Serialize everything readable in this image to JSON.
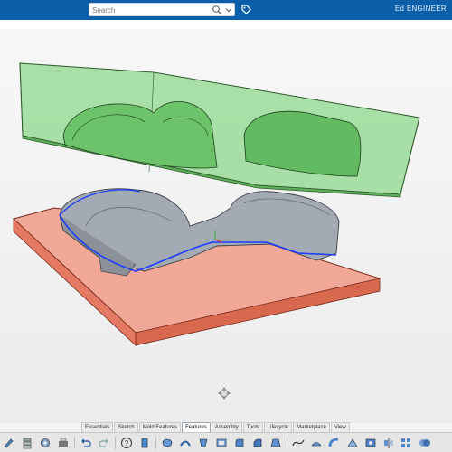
{
  "header": {
    "search_placeholder": "Search",
    "user_name": "Ed ENGINEER",
    "brand_color": "#0b5fa8"
  },
  "icons": {
    "search": "magnifier-icon",
    "dropdown": "chevron-down-icon",
    "tag": "tag-icon",
    "compass": "move-compass-icon"
  },
  "model": {
    "upper_mold_color": "#7ccf7a",
    "lower_mold_color": "#f08a73",
    "part_color": "#9aa0a8",
    "parting_line_color": "#1a3cff"
  },
  "tabs": [
    {
      "label": "Essentials",
      "active": false
    },
    {
      "label": "Sketch",
      "active": false
    },
    {
      "label": "Mold Features",
      "active": false
    },
    {
      "label": "Features",
      "active": true
    },
    {
      "label": "Assembly",
      "active": false
    },
    {
      "label": "Tools",
      "active": false
    },
    {
      "label": "Lifecycle",
      "active": false
    },
    {
      "label": "Marketplace",
      "active": false
    },
    {
      "label": "View",
      "active": false
    }
  ]
}
